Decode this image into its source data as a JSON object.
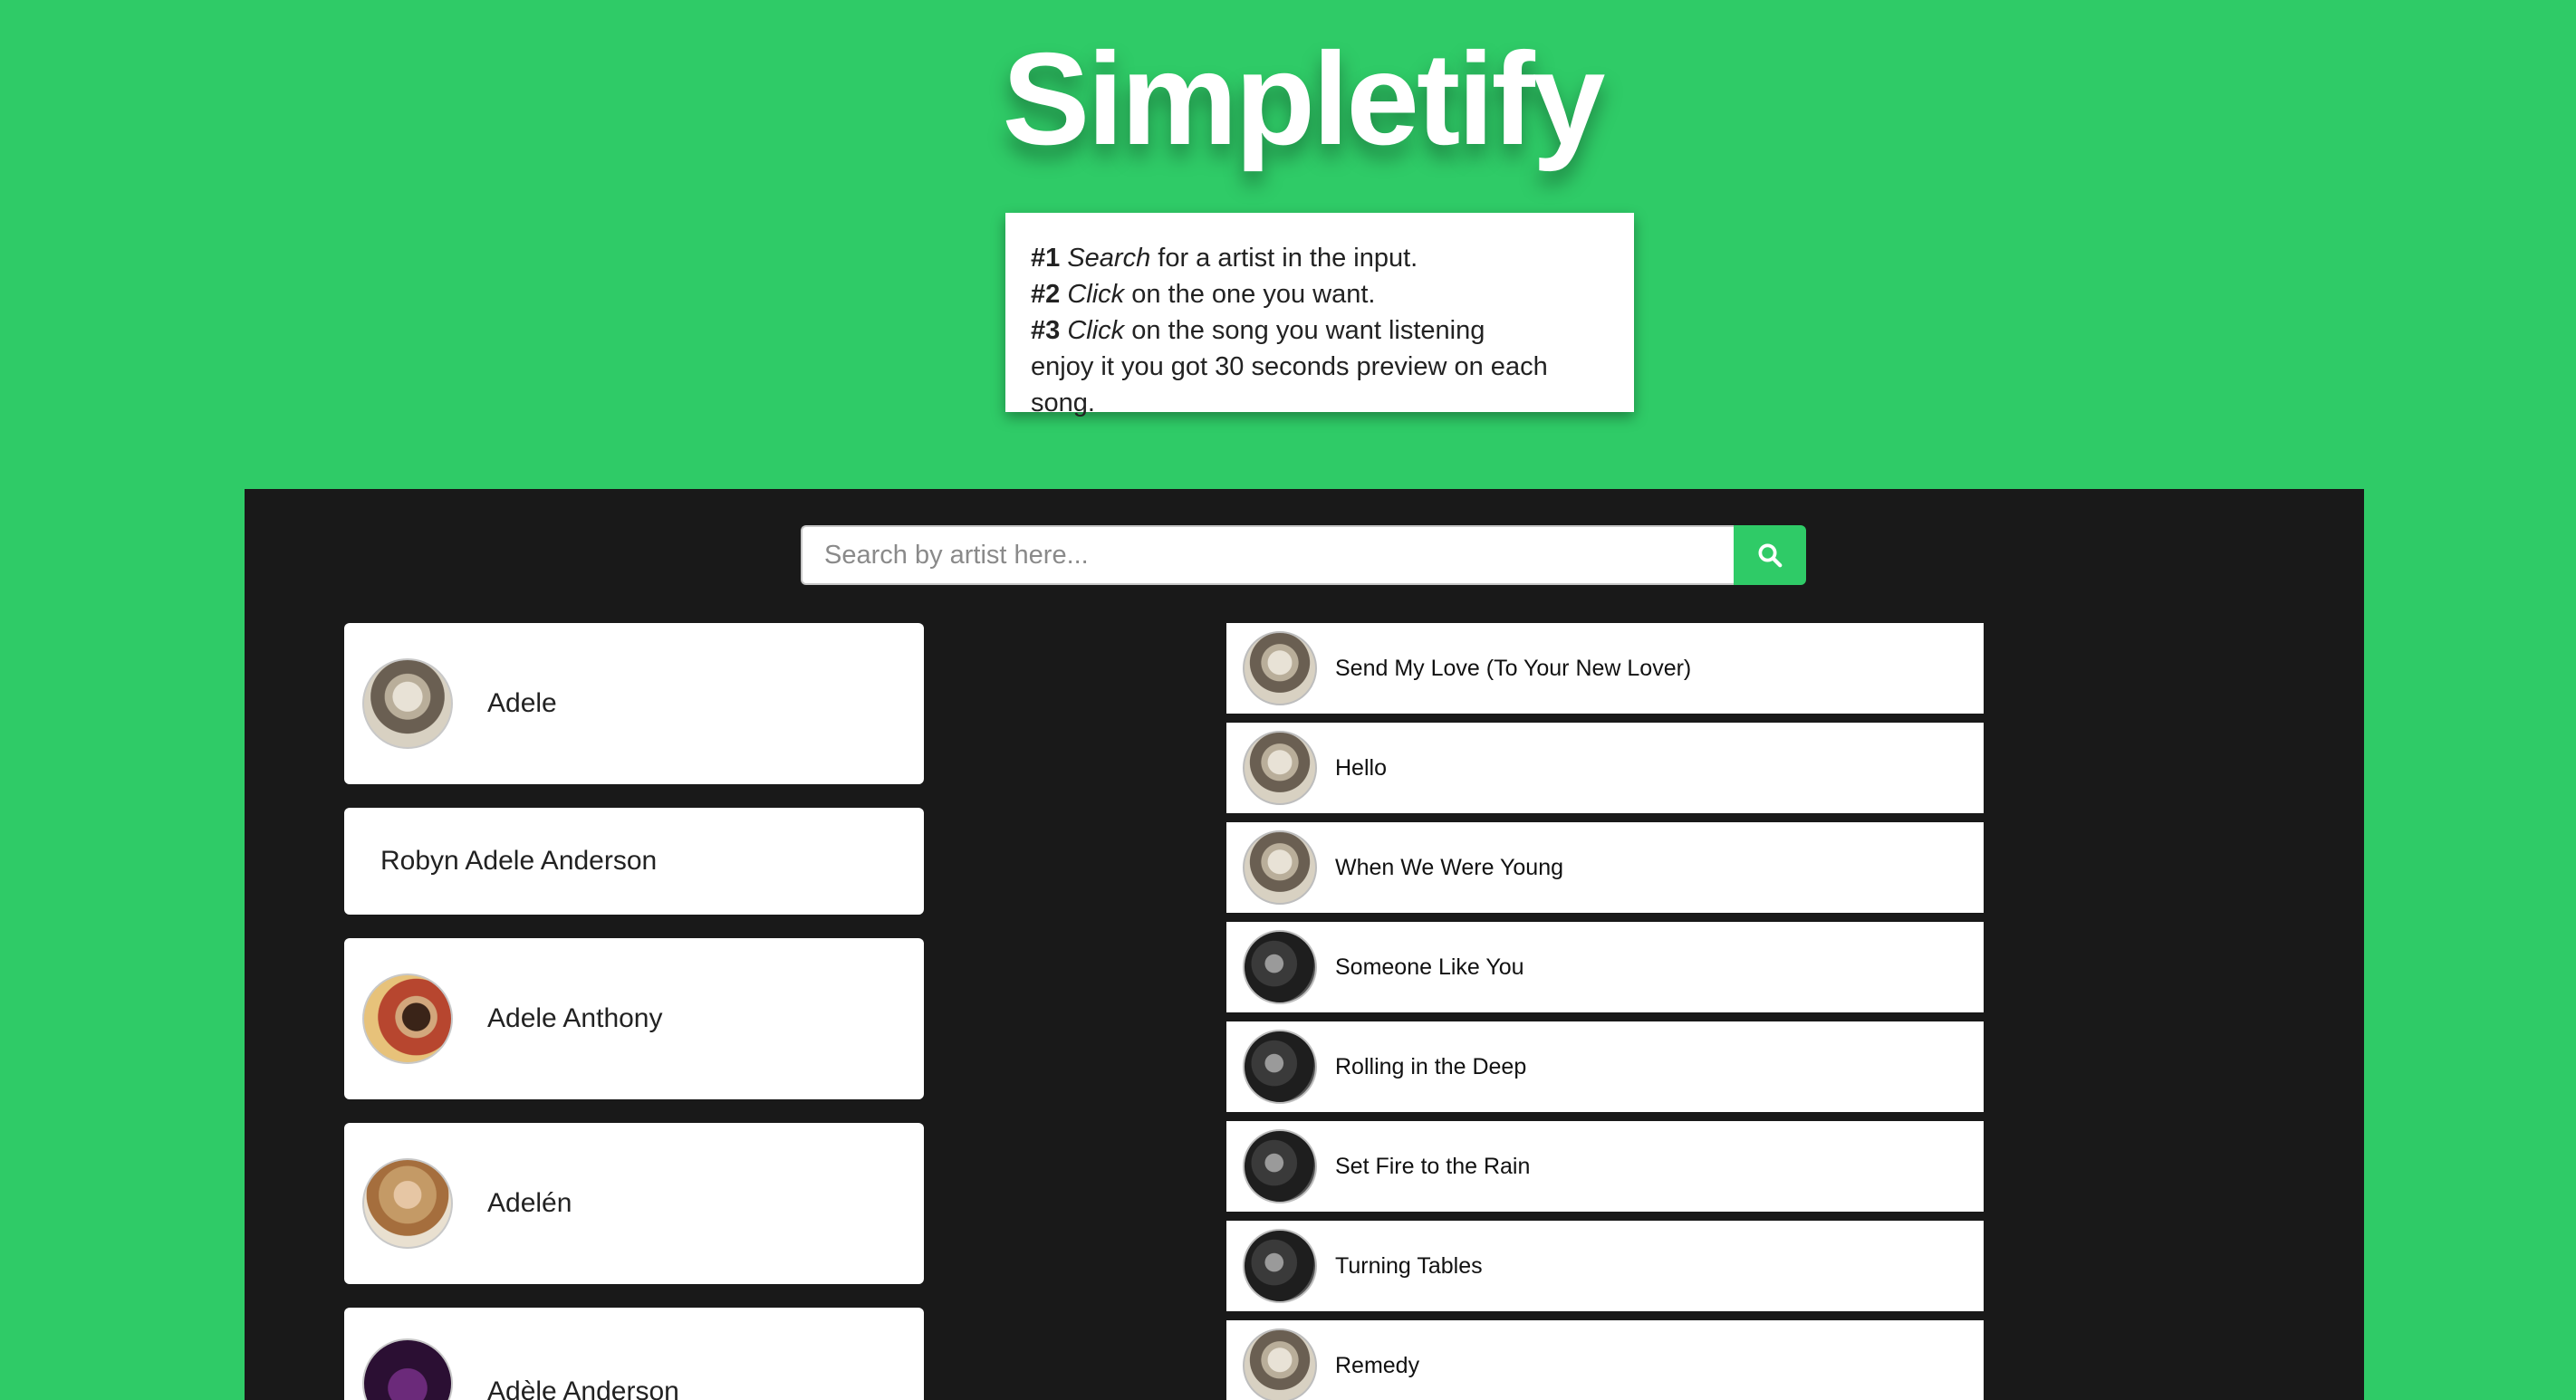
{
  "app": {
    "title": "Simpletify"
  },
  "instructions": [
    {
      "num": "#1",
      "verb": "Search",
      "rest": " for a artist in the input."
    },
    {
      "num": "#2",
      "verb": "Click",
      "rest": " on the one you want."
    },
    {
      "num": "#3",
      "verb": "Click",
      "rest": " on the song you want listening"
    }
  ],
  "instructions_footer": "enjoy it you got 30 seconds preview on each song.",
  "search": {
    "placeholder": "Search by artist here...",
    "value": "",
    "button_icon": "search-icon"
  },
  "artists": [
    {
      "name": "Adele",
      "image": "face-light"
    },
    {
      "name": "Robyn Adele Anderson",
      "image": ""
    },
    {
      "name": "Adele Anthony",
      "image": "face-anthony"
    },
    {
      "name": "Adelén",
      "image": "face-adelen"
    },
    {
      "name": "Adèle Anderson",
      "image": "face-anderson"
    }
  ],
  "songs": [
    {
      "title": "Send My Love (To Your New Lover)",
      "cover": "face-light"
    },
    {
      "title": "Hello",
      "cover": "face-light"
    },
    {
      "title": "When We Were Young",
      "cover": "face-light"
    },
    {
      "title": "Someone Like You",
      "cover": "face-dark"
    },
    {
      "title": "Rolling in the Deep",
      "cover": "face-dark"
    },
    {
      "title": "Set Fire to the Rain",
      "cover": "face-dark"
    },
    {
      "title": "Turning Tables",
      "cover": "face-dark"
    },
    {
      "title": "Remedy",
      "cover": "face-light"
    }
  ],
  "colors": {
    "background": "#2fcb67",
    "panel": "#191919",
    "accent": "#2fcb67"
  }
}
